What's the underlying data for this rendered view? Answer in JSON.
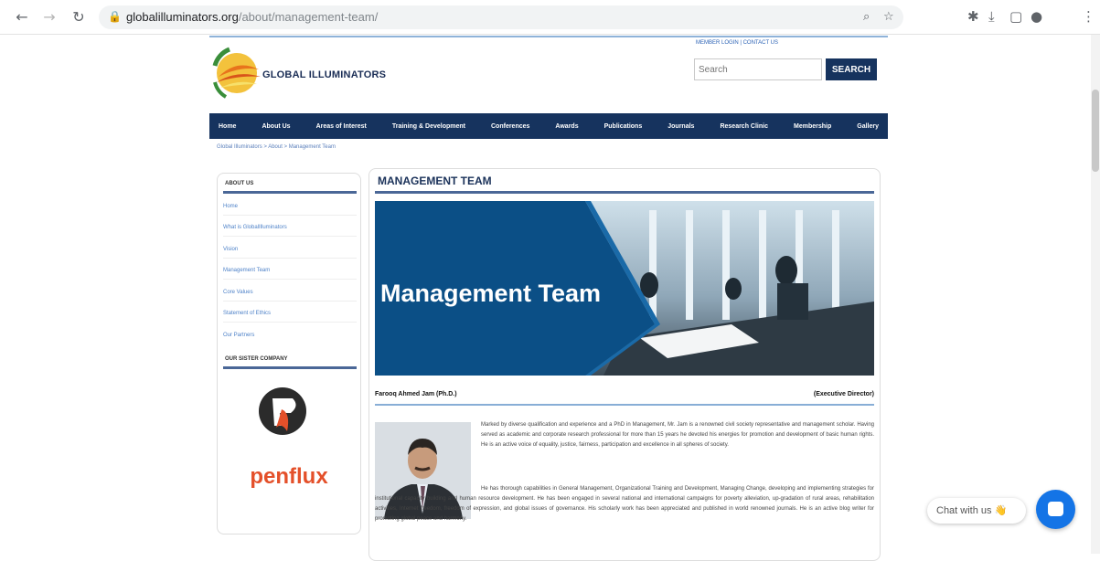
{
  "browser": {
    "url_host": "globalilluminators.org",
    "url_path": "/about/management-team/"
  },
  "site": {
    "brand": "GLOBAL ILLUMINATORS",
    "top_links": "MEMBER LOGIN | CONTACT US",
    "search_placeholder": "Search",
    "search_button": "SEARCH"
  },
  "nav": [
    "Home",
    "About Us",
    "Areas of Interest",
    "Training & Development",
    "Conferences",
    "Awards",
    "Publications",
    "Journals",
    "Research Clinic",
    "Membership",
    "Gallery"
  ],
  "breadcrumb": "Global Illuminators > About > Management Team",
  "sidebar": {
    "heading": "ABOUT US",
    "links": [
      "Home",
      "What is GlobalIlluminators",
      "Vision",
      "Management Team",
      "Core Values",
      "Statement of Ethics",
      "Our Partners"
    ],
    "sister_heading": "OUR SISTER COMPANY",
    "sister_name": "penflux"
  },
  "main": {
    "title": "MANAGEMENT TEAM",
    "banner_text": "Management Team",
    "person_name": "Farooq Ahmed Jam (Ph.D.)",
    "person_role": "(Executive Director)",
    "paragraphs": [
      "Marked by diverse qualification and experience and a PhD in Management, Mr. Jam is a renowned civil society representative and management scholar. Having served as academic and corporate research professional for more than 15 years he devoted his energies for promotion and development of basic human rights. He is an active voice of equality, justice, fairness, participation and excellence in all spheres of society.",
      "He has thorough capabilities in General Management, Organizational Training and Development, Managing Change, developing and implementing strategies for institutional capacity building and human resource development. He has been engaged in several national and international campaigns for poverty alleviation, up-gradation of rural areas, rehabilitation activities, Internet freedom, freedom of expression, and global issues of governance. His scholarly work has been appreciated and published in world renowned journals. He is an active blog writer for promoting global peace and harmony."
    ]
  },
  "chat": {
    "label": "Chat with us 👋"
  }
}
